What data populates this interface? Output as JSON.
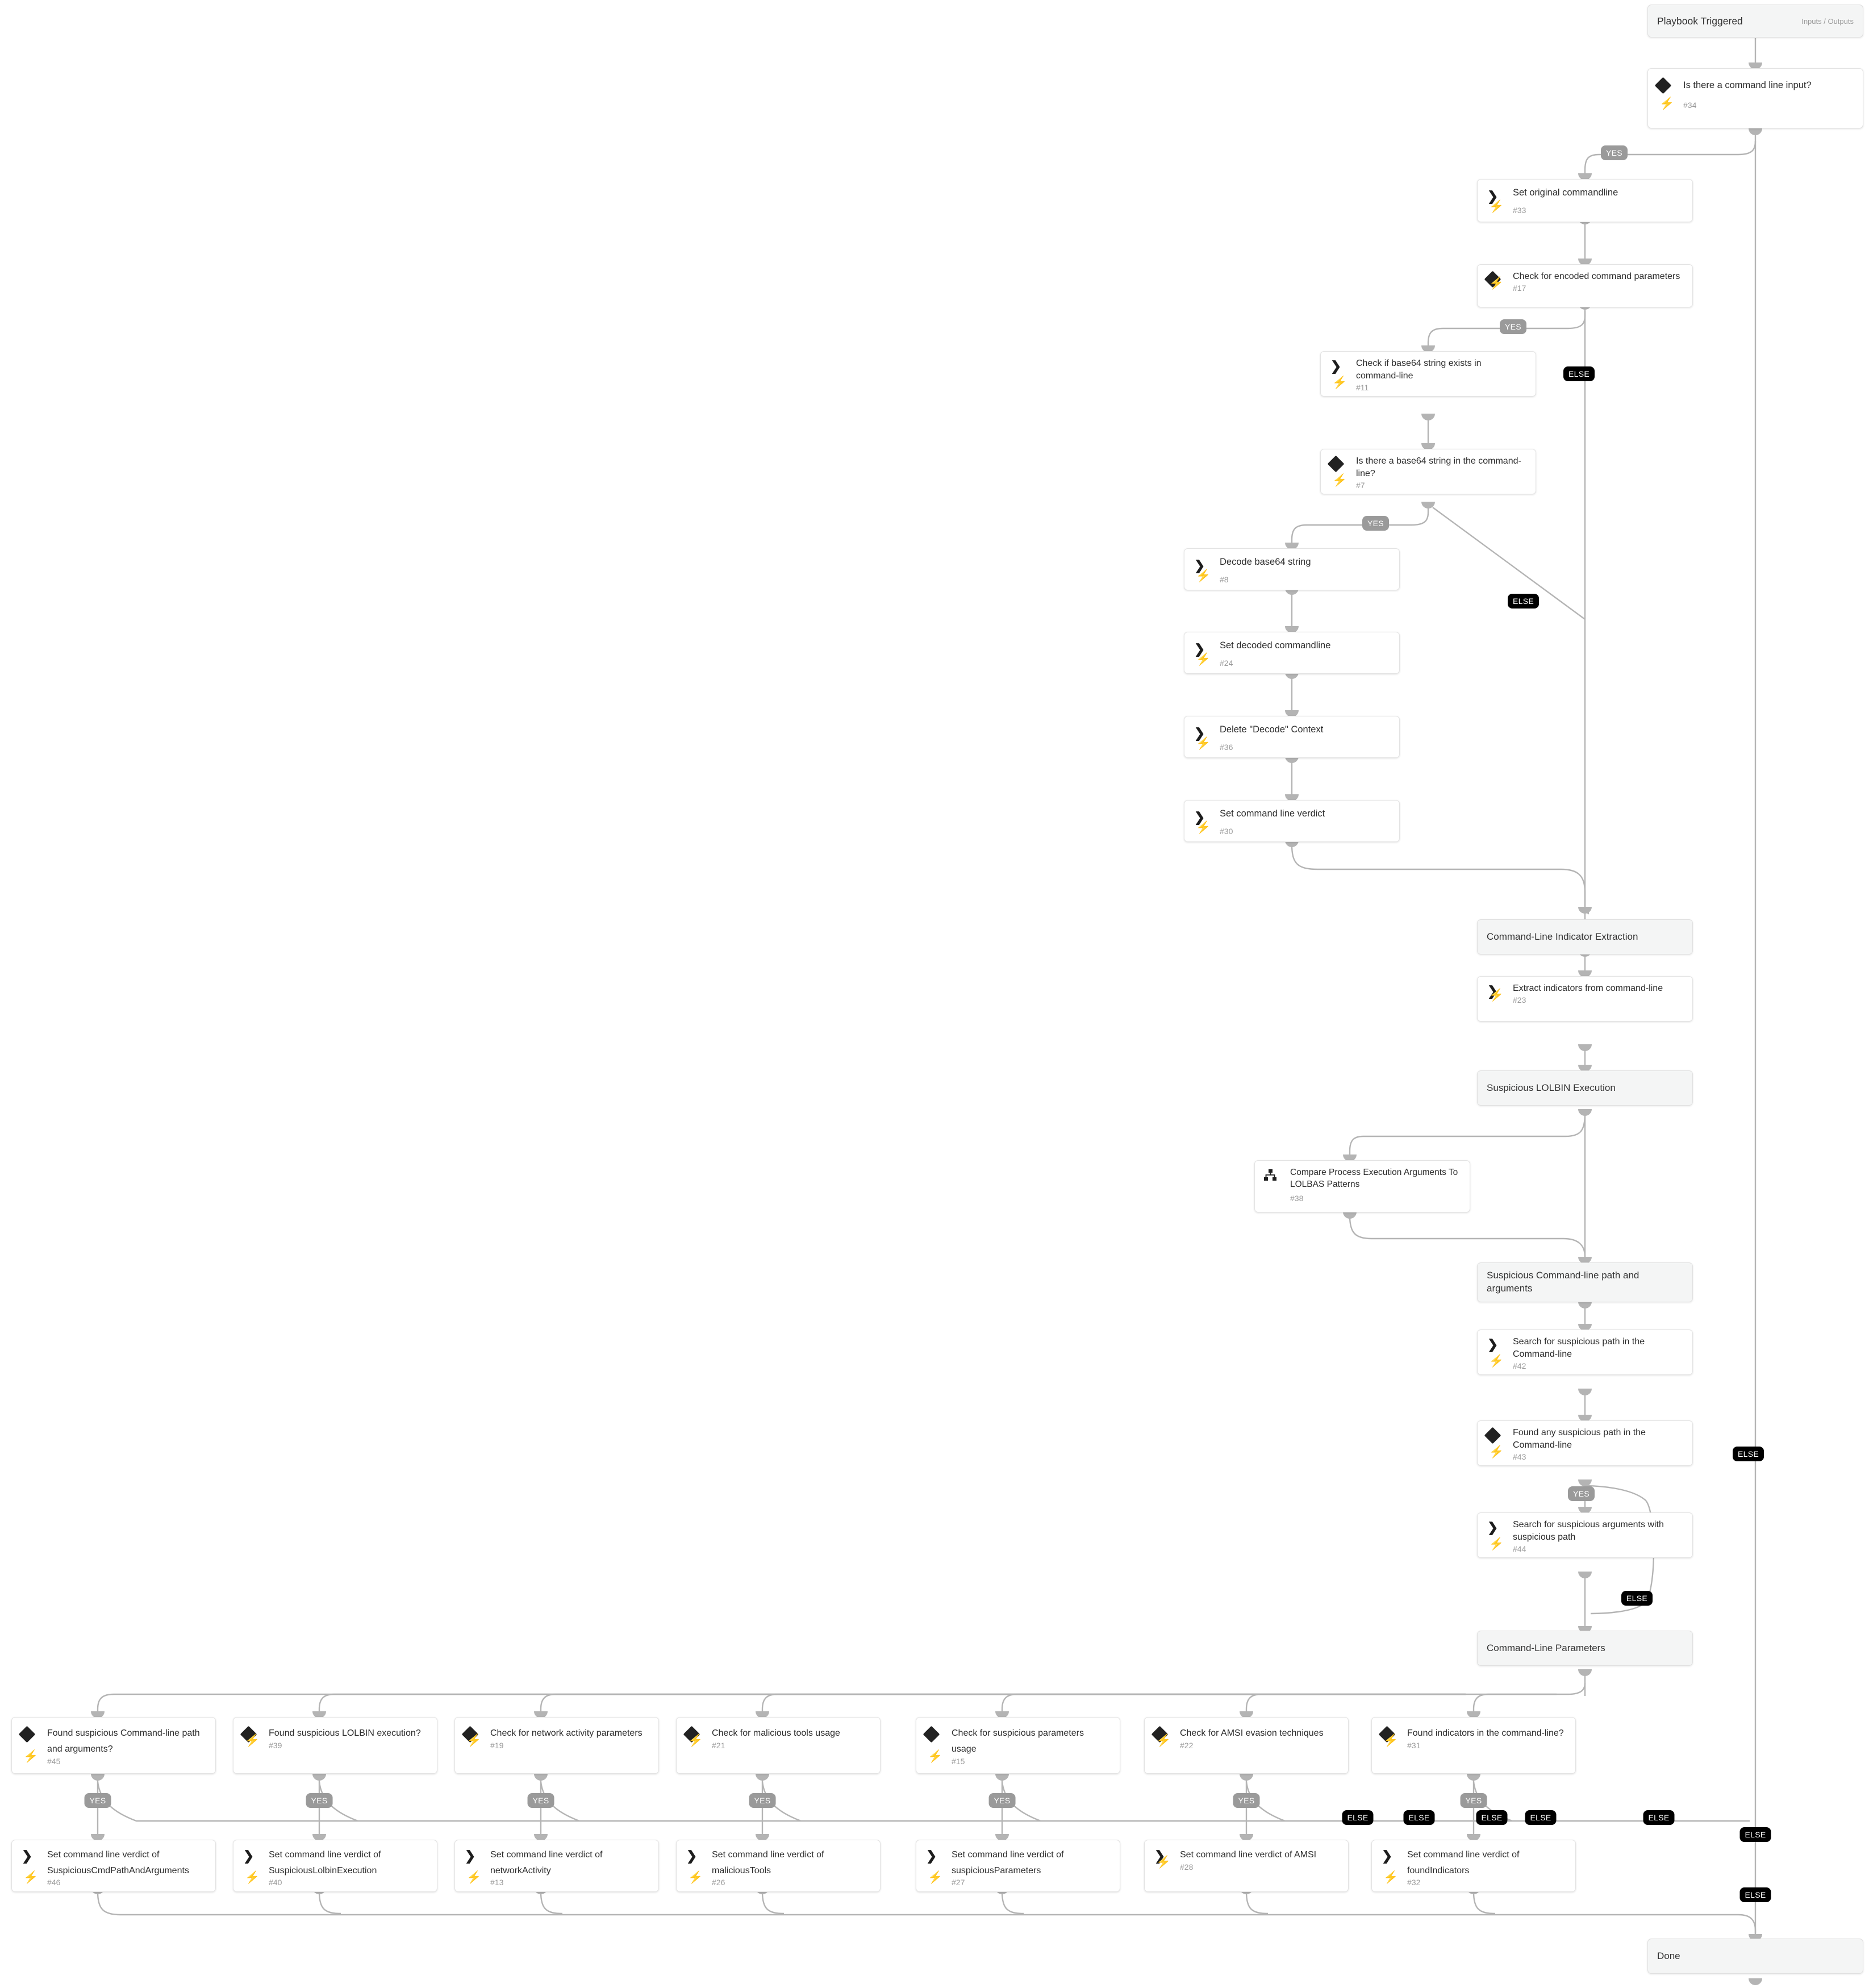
{
  "trigger": {
    "title": "Playbook Triggered",
    "io_label": "Inputs / Outputs"
  },
  "end": {
    "label": "Done"
  },
  "sections": [
    {
      "label": "Command-Line Indicator Extraction"
    },
    {
      "label": "Suspicious LOLBIN Execution"
    },
    {
      "label": "Suspicious Command-line path and arguments"
    },
    {
      "label": "Command-Line Parameters"
    }
  ],
  "branch_labels": {
    "yes": "YES",
    "else": "ELSE"
  },
  "nodes": [
    {
      "id": "#34",
      "title": "Is there a command line input?",
      "type": "condition"
    },
    {
      "id": "#33",
      "title": "Set original commandline",
      "type": "task"
    },
    {
      "id": "#17",
      "title": "Check for encoded command parameters",
      "type": "condition"
    },
    {
      "id": "#11",
      "title": "Check if base64 string exists in command-line",
      "type": "task"
    },
    {
      "id": "#7",
      "title": "Is there a base64 string in the command-line?",
      "type": "condition"
    },
    {
      "id": "#8",
      "title": "Decode base64 string",
      "type": "task"
    },
    {
      "id": "#24",
      "title": "Set decoded commandline",
      "type": "task"
    },
    {
      "id": "#36",
      "title": "Delete \"Decode\" Context",
      "type": "task"
    },
    {
      "id": "#30",
      "title": "Set command line verdict",
      "type": "task"
    },
    {
      "id": "#23",
      "title": "Extract indicators from command-line",
      "type": "task"
    },
    {
      "id": "#38",
      "title": "Compare Process Execution Arguments To LOLBAS Patterns",
      "type": "subplaybook"
    },
    {
      "id": "#42",
      "title": "Search for suspicious path in the Command-line",
      "type": "task"
    },
    {
      "id": "#43",
      "title": "Found any suspicious path in the Command-line",
      "type": "condition"
    },
    {
      "id": "#44",
      "title": "Search for suspicious arguments with suspicious path",
      "type": "task"
    },
    {
      "id": "#45",
      "title": "Found suspicious Command-line path and arguments?",
      "type": "condition"
    },
    {
      "id": "#39",
      "title": "Found suspicious LOLBIN execution?",
      "type": "condition"
    },
    {
      "id": "#19",
      "title": "Check for network activity parameters",
      "type": "condition"
    },
    {
      "id": "#21",
      "title": "Check for malicious tools usage",
      "type": "condition"
    },
    {
      "id": "#15",
      "title": "Check for suspicious parameters usage",
      "type": "condition"
    },
    {
      "id": "#22",
      "title": "Check for AMSI evasion techniques",
      "type": "condition"
    },
    {
      "id": "#31",
      "title": "Found indicators in the command-line?",
      "type": "condition"
    },
    {
      "id": "#46",
      "title": "Set command line verdict of SuspiciousCmdPathAndArguments",
      "type": "task"
    },
    {
      "id": "#40",
      "title": "Set command line verdict of SuspiciousLolbinExecution",
      "type": "task"
    },
    {
      "id": "#13",
      "title": "Set command line verdict of networkActivity",
      "type": "task"
    },
    {
      "id": "#26",
      "title": "Set command line verdict of maliciousTools",
      "type": "task"
    },
    {
      "id": "#27",
      "title": "Set command line verdict of suspiciousParameters",
      "type": "task"
    },
    {
      "id": "#28",
      "title": "Set command line verdict of AMSI",
      "type": "task"
    },
    {
      "id": "#32",
      "title": "Set command line verdict of foundIndicators",
      "type": "task"
    }
  ],
  "colors": {
    "accent_bolt": "#f5a623",
    "edge": "#b4b4b4",
    "badge_yes": "#9a9a9a",
    "badge_else": "#000000",
    "section_bg": "#f4f5f5"
  }
}
